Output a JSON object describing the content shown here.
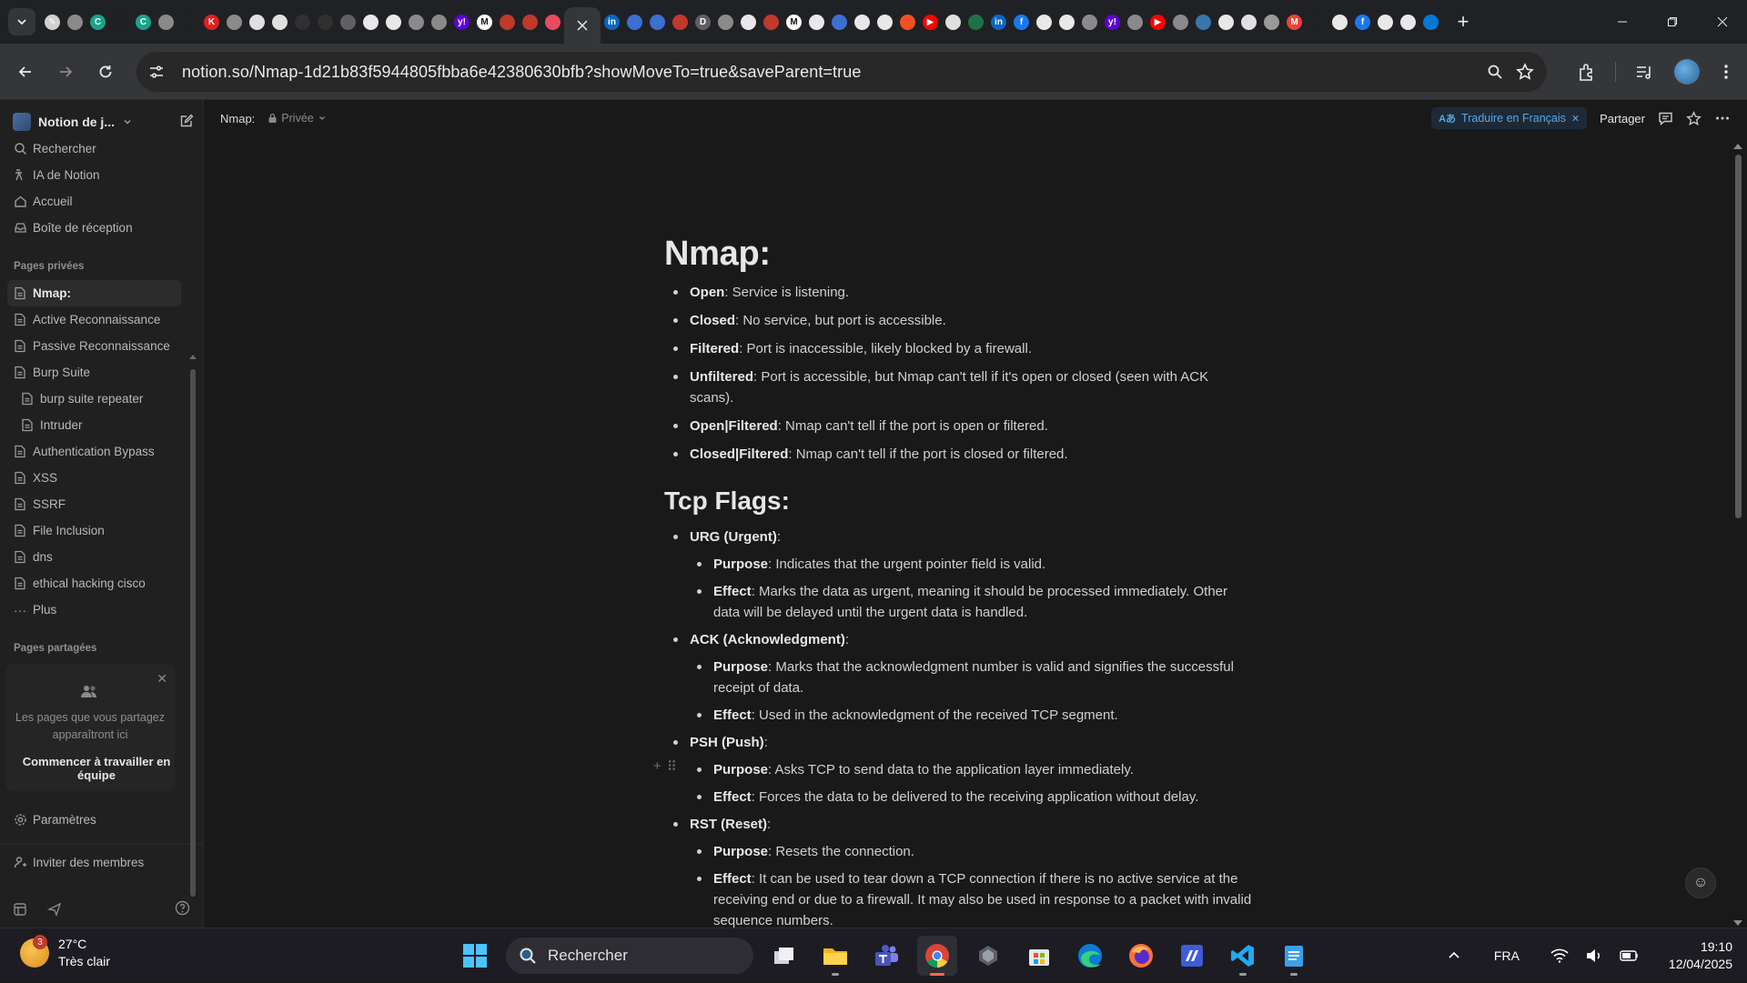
{
  "browser": {
    "tab_icons": [
      {
        "name": "tool-tab-icon",
        "color": "#d0d0d0",
        "glyph": "✎"
      },
      {
        "name": "chrome-tab-icon",
        "color": "#8a8a8a",
        "glyph": ""
      },
      {
        "name": "c-tab-icon",
        "color": "#1aa38c",
        "glyph": "C"
      },
      {
        "name": "blank-tab-icon",
        "color": "#202124",
        "glyph": ""
      },
      {
        "name": "c-tab-icon",
        "color": "#1aa38c",
        "glyph": "C"
      },
      {
        "name": "chrome-tab-icon",
        "color": "#8a8a8a",
        "glyph": ""
      },
      {
        "name": "blank-tab-icon",
        "color": "#202124",
        "glyph": ""
      },
      {
        "name": "k-tab-icon",
        "color": "#e02020",
        "glyph": "K"
      },
      {
        "name": "chrome-tab-icon",
        "color": "#8a8a8a",
        "glyph": ""
      },
      {
        "name": "openai-tab-icon",
        "color": "#e0e0e0",
        "glyph": ""
      },
      {
        "name": "openai-tab-icon",
        "color": "#e0e0e0",
        "glyph": ""
      },
      {
        "name": "nist-tab-icon",
        "color": "#303030",
        "glyph": ""
      },
      {
        "name": "nist-tab-icon",
        "color": "#303030",
        "glyph": ""
      },
      {
        "name": "book-tab-icon",
        "color": "#606060",
        "glyph": ""
      },
      {
        "name": "github-tab-icon",
        "color": "#e8e8e8",
        "glyph": ""
      },
      {
        "name": "github-tab-icon",
        "color": "#e8e8e8",
        "glyph": ""
      },
      {
        "name": "chrome-tab-icon",
        "color": "#8a8a8a",
        "glyph": ""
      },
      {
        "name": "chrome-tab-icon",
        "color": "#8a8a8a",
        "glyph": ""
      },
      {
        "name": "yahoo-tab-icon",
        "color": "#6001d2",
        "glyph": "y!"
      },
      {
        "name": "medium-tab-icon",
        "color": "#ffffff",
        "glyph": "M"
      },
      {
        "name": "cloud-tab-icon",
        "color": "#c0392b",
        "glyph": ""
      },
      {
        "name": "cloud-tab-icon",
        "color": "#c0392b",
        "glyph": ""
      },
      {
        "name": "app-tab-icon",
        "color": "#e84a5f",
        "glyph": ""
      }
    ],
    "tab_icons_right": [
      {
        "name": "linkedin-tab-icon",
        "color": "#0a66c2",
        "glyph": "in"
      },
      {
        "name": "bird-tab-icon",
        "color": "#3b6fd1",
        "glyph": ""
      },
      {
        "name": "bird-tab-icon",
        "color": "#3b6fd1",
        "glyph": ""
      },
      {
        "name": "cloud-tab-icon",
        "color": "#c0392b",
        "glyph": ""
      },
      {
        "name": "d-tab-icon",
        "color": "#606060",
        "glyph": "D"
      },
      {
        "name": "chrome-tab-icon",
        "color": "#8a8a8a",
        "glyph": ""
      },
      {
        "name": "github-tab-icon",
        "color": "#e8e8e8",
        "glyph": ""
      },
      {
        "name": "cloud-tab-icon",
        "color": "#c0392b",
        "glyph": ""
      },
      {
        "name": "medium-tab-icon",
        "color": "#ffffff",
        "glyph": "M"
      },
      {
        "name": "github-tab-icon",
        "color": "#e8e8e8",
        "glyph": ""
      },
      {
        "name": "bird-tab-icon",
        "color": "#3b6fd1",
        "glyph": ""
      },
      {
        "name": "github-tab-icon",
        "color": "#e8e8e8",
        "glyph": ""
      },
      {
        "name": "github-tab-icon",
        "color": "#e8e8e8",
        "glyph": ""
      },
      {
        "name": "microsoft-tab-icon",
        "color": "#f25022",
        "glyph": ""
      },
      {
        "name": "youtube-tab-icon",
        "color": "#ff0000",
        "glyph": "▶"
      },
      {
        "name": "openai-tab-icon",
        "color": "#e0e0e0",
        "glyph": ""
      },
      {
        "name": "sheet-tab-icon",
        "color": "#1e7145",
        "glyph": ""
      },
      {
        "name": "linkedin-tab-icon",
        "color": "#0a66c2",
        "glyph": "in"
      },
      {
        "name": "facebook-tab-icon",
        "color": "#1877f2",
        "glyph": "f"
      },
      {
        "name": "github-tab-icon",
        "color": "#e8e8e8",
        "glyph": ""
      },
      {
        "name": "github-tab-icon",
        "color": "#e8e8e8",
        "glyph": ""
      },
      {
        "name": "chrome-tab-icon",
        "color": "#8a8a8a",
        "glyph": ""
      },
      {
        "name": "yahoo-tab-icon",
        "color": "#6001d2",
        "glyph": "y!"
      },
      {
        "name": "chrome-tab-icon",
        "color": "#8a8a8a",
        "glyph": ""
      },
      {
        "name": "youtube-tab-icon",
        "color": "#ff0000",
        "glyph": "▶"
      },
      {
        "name": "chrome-tab-icon",
        "color": "#8a8a8a",
        "glyph": ""
      },
      {
        "name": "python-tab-icon",
        "color": "#3776ab",
        "glyph": ""
      },
      {
        "name": "github-tab-icon",
        "color": "#e8e8e8",
        "glyph": ""
      },
      {
        "name": "openai-tab-icon",
        "color": "#e0e0e0",
        "glyph": ""
      },
      {
        "name": "audio-tab-icon",
        "color": "#9a9a9a",
        "glyph": ""
      },
      {
        "name": "gmail-tab-icon",
        "color": "#ea4335",
        "glyph": "M"
      },
      {
        "name": "blank-tab-icon",
        "color": "#202124",
        "glyph": ""
      },
      {
        "name": "github-tab-icon",
        "color": "#e8e8e8",
        "glyph": ""
      },
      {
        "name": "facebook-tab-icon",
        "color": "#1877f2",
        "glyph": "f"
      },
      {
        "name": "github-tab-icon",
        "color": "#e8e8e8",
        "glyph": ""
      },
      {
        "name": "github-tab-icon",
        "color": "#e8e8e8",
        "glyph": ""
      },
      {
        "name": "outlook-tab-icon",
        "color": "#0078d4",
        "glyph": ""
      }
    ],
    "url": "notion.so/Nmap-1d21b83f5944805fbba6e42380630bfb?showMoveTo=true&saveParent=true"
  },
  "sidebar": {
    "workspace": "Notion de j...",
    "nav": [
      "Rechercher",
      "IA de Notion",
      "Accueil",
      "Boîte de réception"
    ],
    "private_label": "Pages privées",
    "pages": [
      {
        "label": "Nmap:",
        "active": true,
        "child": false
      },
      {
        "label": "Active Reconnaissance",
        "child": false
      },
      {
        "label": "Passive Reconnaissance",
        "child": false
      },
      {
        "label": "Burp Suite",
        "child": false
      },
      {
        "label": "burp suite repeater",
        "child": true
      },
      {
        "label": "Intruder",
        "child": true
      },
      {
        "label": "Authentication Bypass",
        "child": false
      },
      {
        "label": "XSS",
        "child": false
      },
      {
        "label": "SSRF",
        "child": false
      },
      {
        "label": "File Inclusion",
        "child": false
      },
      {
        "label": "dns",
        "child": false
      },
      {
        "label": "ethical hacking cisco",
        "child": false
      }
    ],
    "more_label": "Plus",
    "shared_label": "Pages partagées",
    "shared_desc": "Les pages que vous partagez apparaîtront ici",
    "team_button": "Commencer à travailler en équipe",
    "settings": "Paramètres",
    "invite": "Inviter des membres"
  },
  "header": {
    "breadcrumb": "Nmap:",
    "privacy": "Privée",
    "translate": "Traduire en Français",
    "share": "Partager"
  },
  "doc": {
    "title": "Nmap:",
    "states": [
      {
        "term": "Open",
        "text": ": Service is listening."
      },
      {
        "term": "Closed",
        "text": ": No service, but port is accessible."
      },
      {
        "term": "Filtered",
        "text": ": Port is inaccessible, likely blocked by a firewall."
      },
      {
        "term": "Unfiltered",
        "text": ": Port is accessible, but Nmap can't tell if it's open or closed (seen with ACK scans)."
      },
      {
        "term": "Open|Filtered",
        "text": ": Nmap can't tell if the port is open or filtered."
      },
      {
        "term": "Closed|Filtered",
        "text": ": Nmap can't tell if the port is closed or filtered."
      }
    ],
    "flags_heading": "Tcp Flags:",
    "flags": [
      {
        "name": "URG (Urgent)",
        "items": [
          {
            "term": "Purpose",
            "text": ": Indicates that the urgent pointer field is valid."
          },
          {
            "term": "Effect",
            "text": ": Marks the data as urgent, meaning it should be processed immediately. Other data will be delayed until the urgent data is handled."
          }
        ]
      },
      {
        "name": "ACK (Acknowledgment)",
        "items": [
          {
            "term": "Purpose",
            "text": ": Marks that the acknowledgment number is valid and signifies the successful receipt of data."
          },
          {
            "term": "Effect",
            "text": ": Used in the acknowledgment of the received TCP segment."
          }
        ]
      },
      {
        "name": "PSH (Push)",
        "items": [
          {
            "term": "Purpose",
            "text": ": Asks TCP to send data to the application layer immediately."
          },
          {
            "term": "Effect",
            "text": ": Forces the data to be delivered to the receiving application without delay."
          }
        ]
      },
      {
        "name": "RST (Reset)",
        "items": [
          {
            "term": "Purpose",
            "text": ": Resets the connection."
          },
          {
            "term": "Effect",
            "text": ": It can be used to tear down a TCP connection if there is no active service at the receiving end or due to a firewall. It may also be used in response to a packet with invalid sequence numbers."
          }
        ]
      }
    ]
  },
  "taskbar": {
    "weather_temp": "27°C",
    "weather_desc": "Très clair",
    "weather_badge": "3",
    "search": "Rechercher",
    "lang": "FRA",
    "time": "19:10",
    "date": "12/04/2025"
  }
}
